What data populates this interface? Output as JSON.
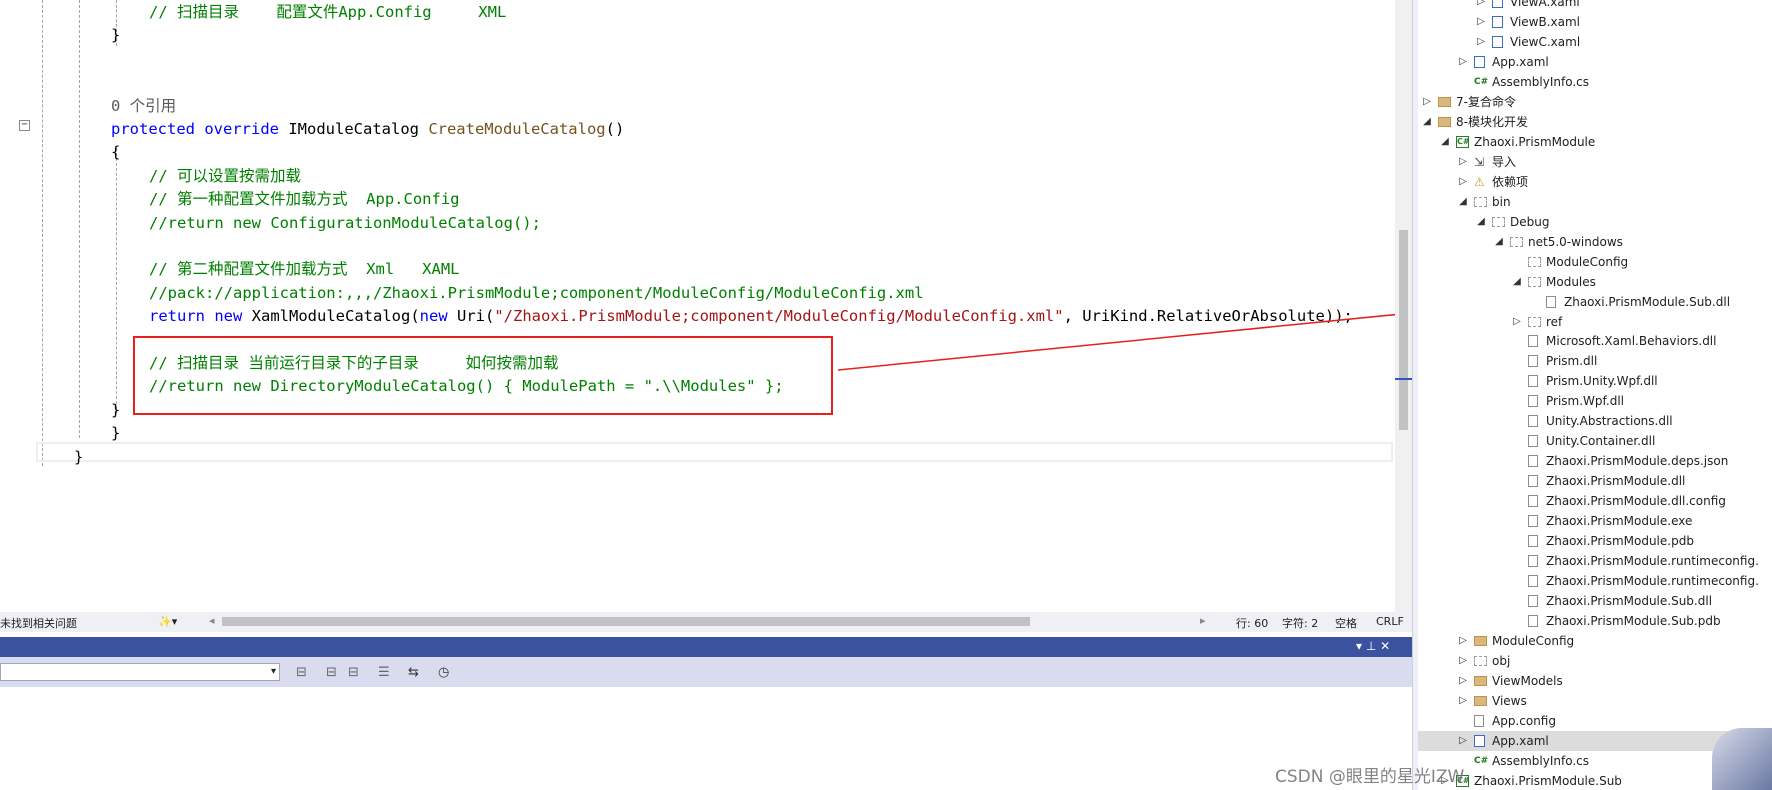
{
  "editor": {
    "lines": [
      {
        "indent": 4,
        "parts": [
          {
            "c": "cmt",
            "t": "// 扫描目录    配置文件App.Config     XML"
          }
        ]
      },
      {
        "indent": 3,
        "parts": [
          {
            "c": "blk",
            "t": "}"
          }
        ]
      },
      {
        "indent": 0,
        "parts": []
      },
      {
        "indent": 0,
        "parts": []
      },
      {
        "indent": 3,
        "parts": [
          {
            "c": "ref",
            "t": "0 个引用"
          }
        ]
      },
      {
        "indent": 3,
        "parts": [
          {
            "c": "kw",
            "t": "protected"
          },
          {
            "c": "blk",
            "t": " "
          },
          {
            "c": "kw",
            "t": "override"
          },
          {
            "c": "blk",
            "t": " IModuleCatalog "
          },
          {
            "c": "fn",
            "t": "CreateModuleCatalog"
          },
          {
            "c": "blk",
            "t": "()"
          }
        ]
      },
      {
        "indent": 3,
        "parts": [
          {
            "c": "blk",
            "t": "{"
          }
        ]
      },
      {
        "indent": 4,
        "parts": [
          {
            "c": "cmt",
            "t": "// 可以设置按需加载"
          }
        ]
      },
      {
        "indent": 4,
        "parts": [
          {
            "c": "cmt",
            "t": "// 第一种配置文件加载方式  App.Config"
          }
        ]
      },
      {
        "indent": 4,
        "parts": [
          {
            "c": "cmt",
            "t": "//return new ConfigurationModuleCatalog();"
          }
        ]
      },
      {
        "indent": 0,
        "parts": []
      },
      {
        "indent": 4,
        "parts": [
          {
            "c": "cmt",
            "t": "// 第二种配置文件加载方式  Xml   XAML"
          }
        ]
      },
      {
        "indent": 4,
        "parts": [
          {
            "c": "cmt",
            "t": "//pack://application:,,,/Zhaoxi.PrismModule;component/ModuleConfig/ModuleConfig.xml"
          }
        ]
      },
      {
        "indent": 4,
        "parts": [
          {
            "c": "kw",
            "t": "return"
          },
          {
            "c": "blk",
            "t": " "
          },
          {
            "c": "kw",
            "t": "new"
          },
          {
            "c": "blk",
            "t": " XamlModuleCatalog("
          },
          {
            "c": "kw",
            "t": "new"
          },
          {
            "c": "blk",
            "t": " Uri("
          },
          {
            "c": "str",
            "t": "\"/Zhaoxi.PrismModule;component/ModuleConfig/ModuleConfig.xml\""
          },
          {
            "c": "blk",
            "t": ", UriKind.RelativeOrAbsolute));"
          }
        ]
      },
      {
        "indent": 0,
        "parts": []
      },
      {
        "indent": 4,
        "parts": [
          {
            "c": "cmt",
            "t": "// 扫描目录 当前运行目录下的子目录     如何按需加载"
          }
        ]
      },
      {
        "indent": 4,
        "parts": [
          {
            "c": "cmt",
            "t": "//return new DirectoryModuleCatalog() { ModulePath = \".\\\\Modules\" };"
          }
        ]
      },
      {
        "indent": 3,
        "parts": [
          {
            "c": "blk",
            "t": "}"
          }
        ]
      },
      {
        "indent": 2,
        "parts": [
          {
            "c": "blk",
            "t": "}"
          }
        ]
      },
      {
        "indent": 1,
        "parts": [
          {
            "c": "blk",
            "t": "}"
          }
        ]
      }
    ],
    "collapse_glyph": "−"
  },
  "status_bar": {
    "issues": "未找到相关问题",
    "brush_icon": "✨▾",
    "line": "行: 60",
    "char": "字符: 2",
    "spaces": "空格",
    "eol": "CRLF",
    "scroll_left": "◂",
    "scroll_right": "▸"
  },
  "panel": {
    "controls": "▾  ⊥  ✕",
    "combo_arrow": "▾",
    "toolbar_icons": [
      "⊟",
      "⊟",
      "⊟",
      "☰",
      "⇆",
      "◷"
    ]
  },
  "explorer": {
    "items": [
      {
        "level": 5,
        "exp": "▷",
        "icon": "xaml",
        "label": "ViewA.xaml"
      },
      {
        "level": 5,
        "exp": "▷",
        "icon": "xaml",
        "label": "ViewB.xaml"
      },
      {
        "level": 5,
        "exp": "▷",
        "icon": "xaml",
        "label": "ViewC.xaml"
      },
      {
        "level": 4,
        "exp": "▷",
        "icon": "xaml",
        "label": "App.xaml"
      },
      {
        "level": 4,
        "exp": "",
        "icon": "cs",
        "label": "AssemblyInfo.cs"
      },
      {
        "level": 2,
        "exp": "▷",
        "icon": "folder",
        "label": "7-复合命令"
      },
      {
        "level": 2,
        "exp": "◢",
        "icon": "folder",
        "label": "8-模块化开发"
      },
      {
        "level": 3,
        "exp": "◢",
        "icon": "proj",
        "label": "Zhaoxi.PrismModule"
      },
      {
        "level": 4,
        "exp": "▷",
        "icon": "ref",
        "label": "导入"
      },
      {
        "level": 4,
        "exp": "▷",
        "icon": "dep",
        "label": "依赖项"
      },
      {
        "level": 4,
        "exp": "◢",
        "icon": "folderg",
        "label": "bin"
      },
      {
        "level": 5,
        "exp": "◢",
        "icon": "folderg",
        "label": "Debug"
      },
      {
        "level": 6,
        "exp": "◢",
        "icon": "folderg",
        "label": "net5.0-windows"
      },
      {
        "level": 7,
        "exp": "",
        "icon": "folderg",
        "label": "ModuleConfig"
      },
      {
        "level": 7,
        "exp": "◢",
        "icon": "folderg",
        "label": "Modules"
      },
      {
        "level": 8,
        "exp": "",
        "icon": "file",
        "label": "Zhaoxi.PrismModule.Sub.dll"
      },
      {
        "level": 7,
        "exp": "▷",
        "icon": "folderg",
        "label": "ref"
      },
      {
        "level": 7,
        "exp": "",
        "icon": "file",
        "label": "Microsoft.Xaml.Behaviors.dll"
      },
      {
        "level": 7,
        "exp": "",
        "icon": "file",
        "label": "Prism.dll"
      },
      {
        "level": 7,
        "exp": "",
        "icon": "file",
        "label": "Prism.Unity.Wpf.dll"
      },
      {
        "level": 7,
        "exp": "",
        "icon": "file",
        "label": "Prism.Wpf.dll"
      },
      {
        "level": 7,
        "exp": "",
        "icon": "file",
        "label": "Unity.Abstractions.dll"
      },
      {
        "level": 7,
        "exp": "",
        "icon": "file",
        "label": "Unity.Container.dll"
      },
      {
        "level": 7,
        "exp": "",
        "icon": "file",
        "label": "Zhaoxi.PrismModule.deps.json"
      },
      {
        "level": 7,
        "exp": "",
        "icon": "file",
        "label": "Zhaoxi.PrismModule.dll"
      },
      {
        "level": 7,
        "exp": "",
        "icon": "file",
        "label": "Zhaoxi.PrismModule.dll.config"
      },
      {
        "level": 7,
        "exp": "",
        "icon": "file",
        "label": "Zhaoxi.PrismModule.exe"
      },
      {
        "level": 7,
        "exp": "",
        "icon": "file",
        "label": "Zhaoxi.PrismModule.pdb"
      },
      {
        "level": 7,
        "exp": "",
        "icon": "file",
        "label": "Zhaoxi.PrismModule.runtimeconfig."
      },
      {
        "level": 7,
        "exp": "",
        "icon": "file",
        "label": "Zhaoxi.PrismModule.runtimeconfig."
      },
      {
        "level": 7,
        "exp": "",
        "icon": "file",
        "label": "Zhaoxi.PrismModule.Sub.dll"
      },
      {
        "level": 7,
        "exp": "",
        "icon": "file",
        "label": "Zhaoxi.PrismModule.Sub.pdb"
      },
      {
        "level": 4,
        "exp": "▷",
        "icon": "folder",
        "label": "ModuleConfig"
      },
      {
        "level": 4,
        "exp": "▷",
        "icon": "folderg",
        "label": "obj"
      },
      {
        "level": 4,
        "exp": "▷",
        "icon": "folder",
        "label": "ViewModels"
      },
      {
        "level": 4,
        "exp": "▷",
        "icon": "folder",
        "label": "Views"
      },
      {
        "level": 4,
        "exp": "",
        "icon": "file",
        "label": "App.config"
      },
      {
        "level": 4,
        "exp": "▷",
        "icon": "xaml",
        "label": "App.xaml",
        "selected": true
      },
      {
        "level": 4,
        "exp": "",
        "icon": "cs",
        "label": "AssemblyInfo.cs"
      },
      {
        "level": 3,
        "exp": "▷",
        "icon": "proj",
        "label": "Zhaoxi.PrismModule.Sub"
      }
    ]
  },
  "watermark": "CSDN @眼里的星光IZW"
}
